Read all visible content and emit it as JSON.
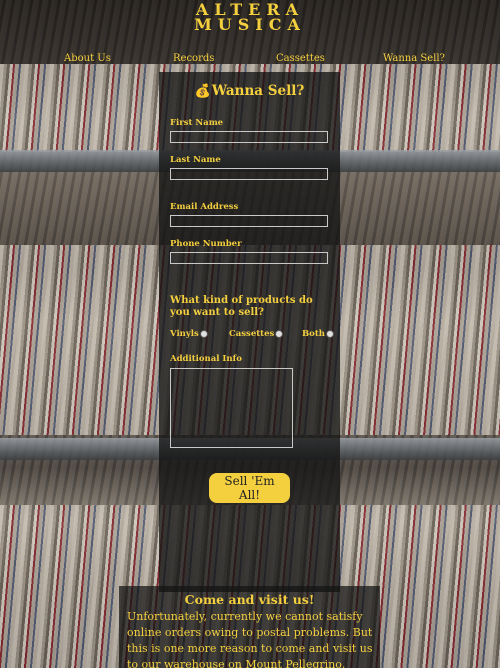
{
  "brand": {
    "line1": "ALTERA",
    "line2": "MUSICA",
    "accent_color": "#f4d03f"
  },
  "nav": {
    "items": [
      {
        "label": "About Us"
      },
      {
        "label": "Records"
      },
      {
        "label": "Cassettes"
      },
      {
        "label": "Wanna Sell?"
      }
    ]
  },
  "form": {
    "title_icon": "money-bag-icon",
    "title": "Wanna Sell?",
    "first_name": {
      "label": "First Name",
      "value": ""
    },
    "last_name": {
      "label": "Last Name",
      "value": ""
    },
    "email": {
      "label": "Email Address",
      "value": ""
    },
    "phone": {
      "label": "Phone Number",
      "value": ""
    },
    "question": "What kind of products do you want to sell?",
    "options": [
      {
        "label": "Vinyls"
      },
      {
        "label": "Cassettes"
      },
      {
        "label": "Both"
      }
    ],
    "additional_info": {
      "label": "Additional Info",
      "value": ""
    },
    "submit_label": "Sell 'Em All!"
  },
  "visit": {
    "title": "Come and visit us!",
    "text": "Unfortunately, currently we cannot satisfy online orders owing to postal problems. But this is one more reason to come and visit us to our warehouse on Mount Pellegrino, Palermo, at anti-aircraft"
  }
}
